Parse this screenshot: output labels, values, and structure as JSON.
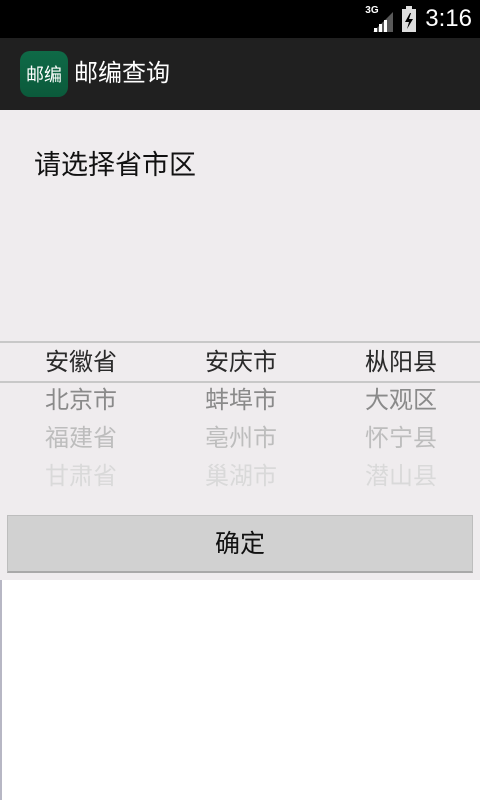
{
  "status_bar": {
    "network_type": "3G",
    "time": "3:16"
  },
  "action_bar": {
    "icon_text": "邮编",
    "title": "邮编查询"
  },
  "main": {
    "prompt": "请选择省市区",
    "picker": {
      "provinces": [
        "安徽省",
        "北京市",
        "福建省",
        "甘肃省"
      ],
      "cities": [
        "安庆市",
        "蚌埠市",
        "亳州市",
        "巢湖市"
      ],
      "districts": [
        "枞阳县",
        "大观区",
        "怀宁县",
        "潜山县"
      ]
    },
    "confirm_label": "确定"
  },
  "colors": {
    "status_bar": "#000000",
    "action_bar": "#202020",
    "content_bg": "#efecee",
    "app_icon": "#0f6a47",
    "button_bg": "#d1d1d1"
  }
}
